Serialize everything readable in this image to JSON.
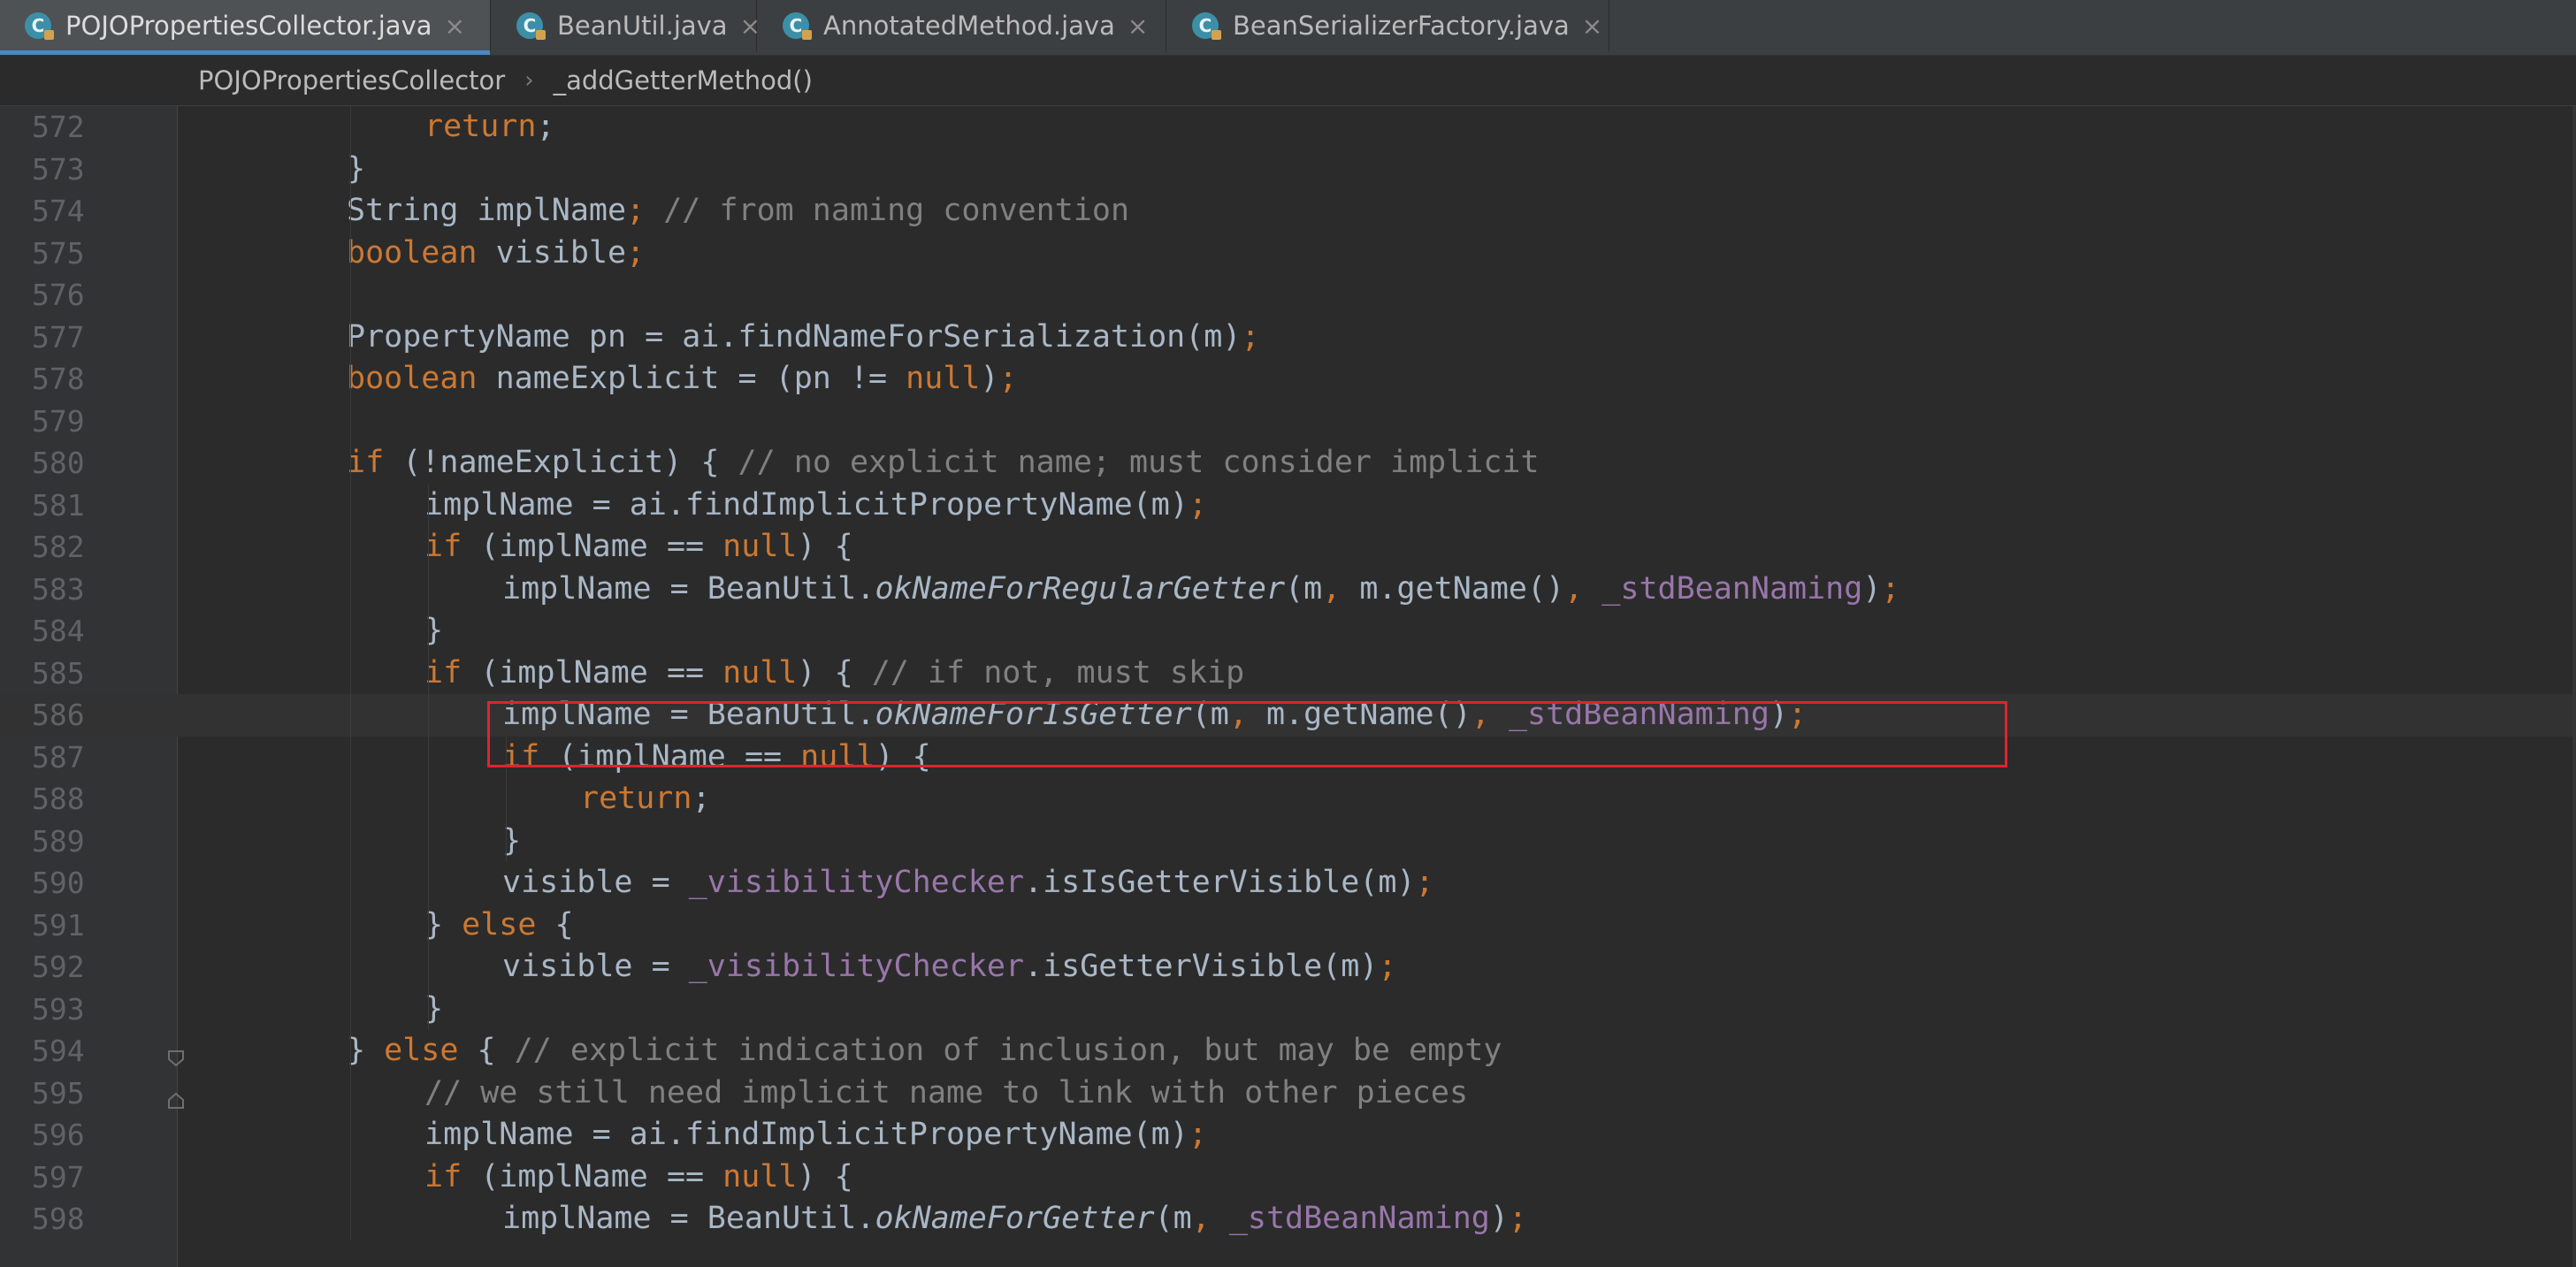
{
  "tabs": [
    {
      "label": "POJOPropertiesCollector.java",
      "active": true
    },
    {
      "label": "BeanUtil.java",
      "active": false
    },
    {
      "label": "AnnotatedMethod.java",
      "active": false
    },
    {
      "label": "BeanSerializerFactory.java",
      "active": false
    }
  ],
  "tab_close_glyph": "×",
  "breadcrumb": {
    "class_name": "POJOPropertiesCollector",
    "separator": "›",
    "method_name": "_addGetterMethod()"
  },
  "colors": {
    "keyword": "#cc7832",
    "comment": "#808080",
    "field": "#9876aa",
    "text": "#a9b7c6",
    "line_number": "#606366",
    "background": "#2b2b2b",
    "highlight_box": "#e0232c",
    "tab_accent": "#4a88c7"
  },
  "icons": {
    "tab_file": "java-class-icon",
    "fold": "fold-marker-icon"
  },
  "highlighted_line": "586",
  "code_lines": [
    {
      "n": "572",
      "indent": 2,
      "tokens": [
        [
          "kw",
          "return"
        ],
        [
          "p",
          ";"
        ]
      ]
    },
    {
      "n": "573",
      "indent": 1,
      "tokens": [
        [
          "p",
          "}"
        ]
      ]
    },
    {
      "n": "574",
      "indent": 1,
      "tokens": [
        [
          "id",
          "String implName"
        ],
        [
          "kw",
          ";"
        ],
        [
          "p",
          " "
        ],
        [
          "cmt",
          "// from naming convention"
        ]
      ]
    },
    {
      "n": "575",
      "indent": 1,
      "tokens": [
        [
          "kw",
          "boolean"
        ],
        [
          "p",
          " visible"
        ],
        [
          "kw",
          ";"
        ]
      ]
    },
    {
      "n": "576",
      "indent": 0,
      "tokens": []
    },
    {
      "n": "577",
      "indent": 1,
      "tokens": [
        [
          "id",
          "PropertyName pn = ai.findNameForSerialization(m)"
        ],
        [
          "kw",
          ";"
        ]
      ]
    },
    {
      "n": "578",
      "indent": 1,
      "tokens": [
        [
          "kw",
          "boolean"
        ],
        [
          "p",
          " nameExplicit = (pn != "
        ],
        [
          "kw",
          "null"
        ],
        [
          "p",
          ")"
        ],
        [
          "kw",
          ";"
        ]
      ]
    },
    {
      "n": "579",
      "indent": 0,
      "tokens": []
    },
    {
      "n": "580",
      "indent": 1,
      "tokens": [
        [
          "kw",
          "if"
        ],
        [
          "p",
          " (!nameExplicit) { "
        ],
        [
          "cmt",
          "// no explicit name; must consider implicit"
        ]
      ]
    },
    {
      "n": "581",
      "indent": 2,
      "tokens": [
        [
          "id",
          "implName = ai.findImplicitPropertyName(m)"
        ],
        [
          "kw",
          ";"
        ]
      ]
    },
    {
      "n": "582",
      "indent": 2,
      "tokens": [
        [
          "kw",
          "if"
        ],
        [
          "p",
          " (implName == "
        ],
        [
          "kw",
          "null"
        ],
        [
          "p",
          ") {"
        ]
      ]
    },
    {
      "n": "583",
      "indent": 3,
      "tokens": [
        [
          "id",
          "implName = BeanUtil."
        ],
        [
          "it",
          "okNameForRegularGetter"
        ],
        [
          "p",
          "(m"
        ],
        [
          "kw",
          ","
        ],
        [
          "p",
          " m.getName()"
        ],
        [
          "kw",
          ","
        ],
        [
          "p",
          " "
        ],
        [
          "fld",
          "_stdBeanNaming"
        ],
        [
          "p",
          ")"
        ],
        [
          "kw",
          ";"
        ]
      ]
    },
    {
      "n": "584",
      "indent": 2,
      "tokens": [
        [
          "p",
          "}"
        ]
      ]
    },
    {
      "n": "585",
      "indent": 2,
      "tokens": [
        [
          "kw",
          "if"
        ],
        [
          "p",
          " (implName == "
        ],
        [
          "kw",
          "null"
        ],
        [
          "p",
          ") { "
        ],
        [
          "cmt",
          "// if not, must skip"
        ]
      ]
    },
    {
      "n": "586",
      "indent": 3,
      "tokens": [
        [
          "id",
          "implName = BeanUtil."
        ],
        [
          "it",
          "okNameForIsGetter"
        ],
        [
          "p",
          "(m"
        ],
        [
          "kw",
          ","
        ],
        [
          "p",
          " m.getName()"
        ],
        [
          "kw",
          ","
        ],
        [
          "p",
          " "
        ],
        [
          "fld",
          "_stdBeanNaming"
        ],
        [
          "p",
          ")"
        ],
        [
          "kw",
          ";"
        ]
      ]
    },
    {
      "n": "587",
      "indent": 3,
      "tokens": [
        [
          "kw",
          "if"
        ],
        [
          "p",
          " (implName == "
        ],
        [
          "kw",
          "null"
        ],
        [
          "p",
          ") {"
        ]
      ]
    },
    {
      "n": "588",
      "indent": 4,
      "tokens": [
        [
          "kw",
          "return"
        ],
        [
          "p",
          ";"
        ]
      ]
    },
    {
      "n": "589",
      "indent": 3,
      "tokens": [
        [
          "p",
          "}"
        ]
      ]
    },
    {
      "n": "590",
      "indent": 3,
      "tokens": [
        [
          "id",
          "visible = "
        ],
        [
          "fld",
          "_visibilityChecker"
        ],
        [
          "p",
          ".isIsGetterVisible(m)"
        ],
        [
          "kw",
          ";"
        ]
      ]
    },
    {
      "n": "591",
      "indent": 2,
      "tokens": [
        [
          "p",
          "} "
        ],
        [
          "kw",
          "else"
        ],
        [
          "p",
          " {"
        ]
      ]
    },
    {
      "n": "592",
      "indent": 3,
      "tokens": [
        [
          "id",
          "visible = "
        ],
        [
          "fld",
          "_visibilityChecker"
        ],
        [
          "p",
          ".isGetterVisible(m)"
        ],
        [
          "kw",
          ";"
        ]
      ]
    },
    {
      "n": "593",
      "indent": 2,
      "tokens": [
        [
          "p",
          "}"
        ]
      ]
    },
    {
      "n": "594",
      "indent": 1,
      "tokens": [
        [
          "p",
          "} "
        ],
        [
          "kw",
          "else"
        ],
        [
          "p",
          " { "
        ],
        [
          "cmt",
          "// explicit indication of inclusion, but may be empty"
        ]
      ]
    },
    {
      "n": "595",
      "indent": 2,
      "tokens": [
        [
          "cmt",
          "// we still need implicit name to link with other pieces"
        ]
      ]
    },
    {
      "n": "596",
      "indent": 2,
      "tokens": [
        [
          "id",
          "implName = ai.findImplicitPropertyName(m)"
        ],
        [
          "kw",
          ";"
        ]
      ]
    },
    {
      "n": "597",
      "indent": 2,
      "tokens": [
        [
          "kw",
          "if"
        ],
        [
          "p",
          " (implName == "
        ],
        [
          "kw",
          "null"
        ],
        [
          "p",
          ") {"
        ]
      ]
    },
    {
      "n": "598",
      "indent": 3,
      "tokens": [
        [
          "id",
          "implName = BeanUtil."
        ],
        [
          "it",
          "okNameForGetter"
        ],
        [
          "p",
          "(m"
        ],
        [
          "kw",
          ","
        ],
        [
          "p",
          " "
        ],
        [
          "fld",
          "_stdBeanNaming"
        ],
        [
          "p",
          ")"
        ],
        [
          "kw",
          ";"
        ]
      ]
    }
  ]
}
